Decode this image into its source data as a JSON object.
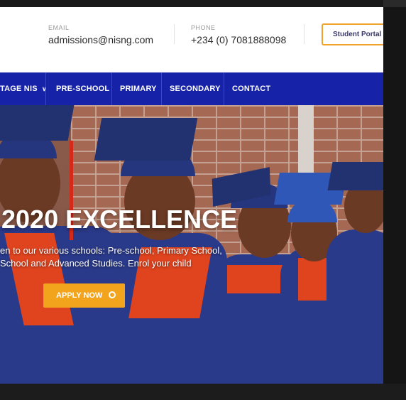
{
  "header": {
    "email": {
      "label": "EMAIL",
      "value": "admissions@nisng.com"
    },
    "phone": {
      "label": "PHONE",
      "value": "+234 (0) 7081888098"
    },
    "portal_button": "Student Portal"
  },
  "nav": {
    "items": [
      {
        "label": "TAGE NIS",
        "has_dropdown": true
      },
      {
        "label": "PRE-SCHOOL"
      },
      {
        "label": "PRIMARY"
      },
      {
        "label": "SECONDARY"
      },
      {
        "label": "CONTACT"
      }
    ],
    "dropdown_glyph": "∨"
  },
  "hero": {
    "title": "2020 EXCELLENCE",
    "subtitle_line1": "en to our various schools: Pre-school, Primary School,",
    "subtitle_line2": "School and Advanced Studies. Enrol your child",
    "cta": "APPLY NOW"
  },
  "colors": {
    "nav_bg": "#1622a8",
    "accent": "#f2a41c",
    "portal_border": "#f0a32a"
  }
}
